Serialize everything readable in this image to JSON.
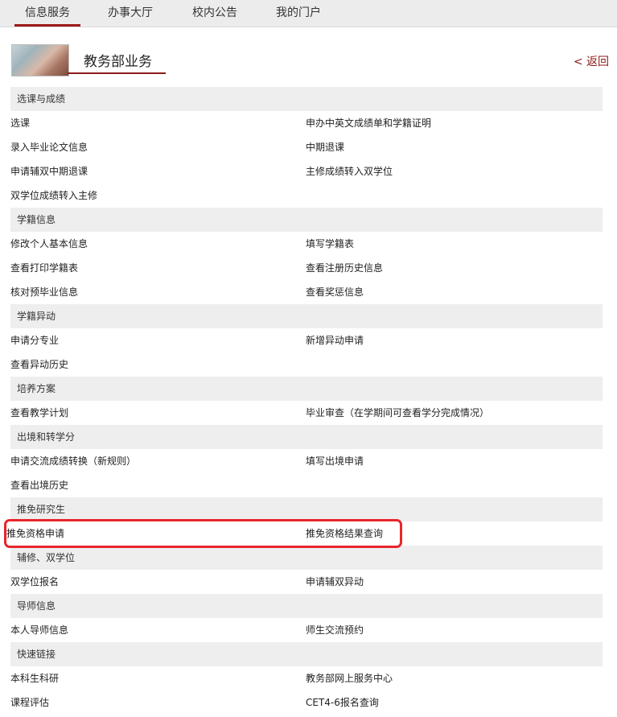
{
  "topnav": {
    "tabs": [
      {
        "label": "信息服务",
        "active": true
      },
      {
        "label": "办事大厅",
        "active": false
      },
      {
        "label": "校内公告",
        "active": false
      },
      {
        "label": "我的门户",
        "active": false
      }
    ]
  },
  "header": {
    "title": "教务部业务",
    "back_label": "< 返回"
  },
  "sections": [
    {
      "title": "选课与成绩",
      "rows": [
        [
          "选课",
          "申办中英文成绩单和学籍证明"
        ],
        [
          "录入毕业论文信息",
          "中期退课"
        ],
        [
          "申请辅双中期退课",
          "主修成绩转入双学位"
        ],
        [
          "双学位成绩转入主修",
          ""
        ]
      ]
    },
    {
      "title": "学籍信息",
      "rows": [
        [
          "修改个人基本信息",
          "填写学籍表"
        ],
        [
          "查看打印学籍表",
          "查看注册历史信息"
        ],
        [
          "核对预毕业信息",
          "查看奖惩信息"
        ]
      ]
    },
    {
      "title": "学籍异动",
      "rows": [
        [
          "申请分专业",
          "新增异动申请"
        ],
        [
          "查看异动历史",
          ""
        ]
      ]
    },
    {
      "title": "培养方案",
      "rows": [
        [
          "查看教学计划",
          "毕业审查（在学期间可查看学分完成情况）"
        ]
      ]
    },
    {
      "title": "出境和转学分",
      "rows": [
        [
          "申请交流成绩转换（新规则）",
          "填写出境申请"
        ],
        [
          "查看出境历史",
          ""
        ]
      ]
    },
    {
      "title": "推免研究生",
      "rows": [
        [
          "推免资格申请",
          "推免资格结果查询"
        ]
      ]
    },
    {
      "title": "辅修、双学位",
      "rows": [
        [
          "双学位报名",
          "申请辅双异动"
        ]
      ]
    },
    {
      "title": "导师信息",
      "rows": [
        [
          "本人导师信息",
          "师生交流预约"
        ]
      ]
    },
    {
      "title": "快速链接",
      "rows": [
        [
          "本科生科研",
          "教务部网上服务中心"
        ],
        [
          "课程评估",
          "CET4-6报名查询"
        ]
      ]
    }
  ],
  "highlight": {
    "section": 5,
    "row": 0
  }
}
